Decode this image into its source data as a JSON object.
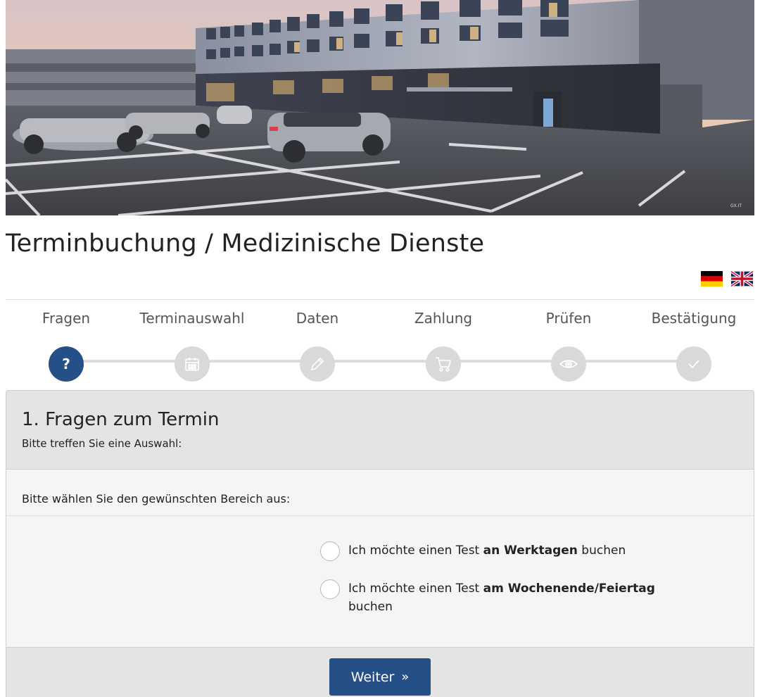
{
  "page": {
    "title": "Terminbuchung / Medizinische Dienste"
  },
  "languages": [
    {
      "code": "de",
      "icon": "flag-germany-icon"
    },
    {
      "code": "en",
      "icon": "flag-uk-icon"
    }
  ],
  "steps": [
    {
      "label": "Fragen",
      "icon": "question-icon",
      "active": true
    },
    {
      "label": "Terminauswahl",
      "icon": "calendar-icon",
      "active": false
    },
    {
      "label": "Daten",
      "icon": "pencil-icon",
      "active": false
    },
    {
      "label": "Zahlung",
      "icon": "cart-icon",
      "active": false
    },
    {
      "label": "Prüfen",
      "icon": "eye-icon",
      "active": false
    },
    {
      "label": "Bestätigung",
      "icon": "check-icon",
      "active": false
    }
  ],
  "panel": {
    "title": "1. Fragen zum Termin",
    "subtitle": "Bitte treffen Sie eine Auswahl:",
    "section_label": "Bitte wählen Sie den gewünschten Bereich aus:",
    "options": [
      {
        "prefix": "Ich möchte einen Test ",
        "bold": "an Werktagen",
        "suffix": " buchen",
        "selected": false
      },
      {
        "prefix": "Ich möchte einen Test ",
        "bold": "am Wochenende/Feiertag",
        "suffix": " buchen",
        "selected": false
      }
    ],
    "next_button": {
      "label": "Weiter",
      "icon": "double-chevron-right-icon"
    }
  },
  "colors": {
    "accent": "#254f87",
    "inactive_step": "#d9d9d9",
    "panel_header": "#e4e4e4"
  }
}
